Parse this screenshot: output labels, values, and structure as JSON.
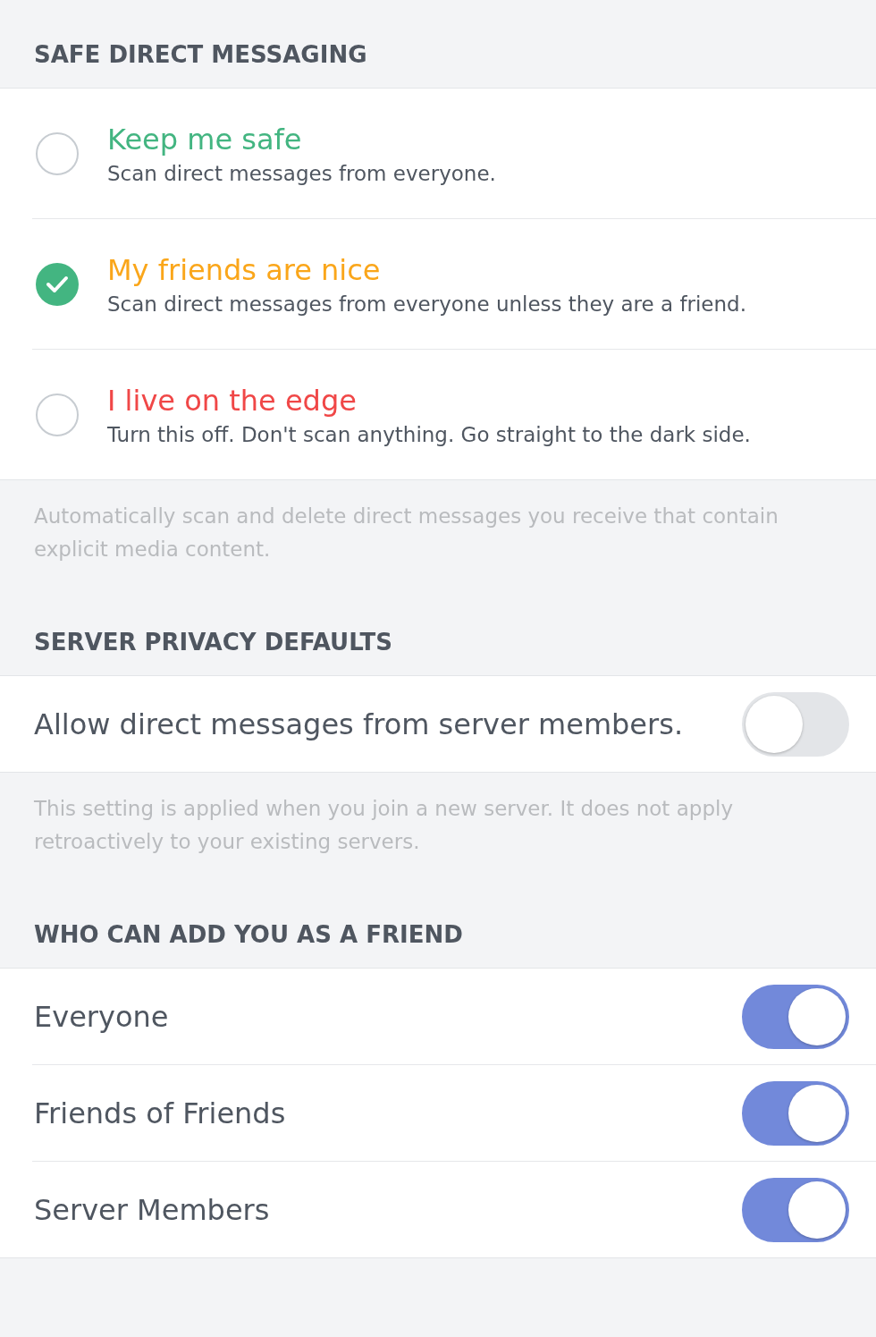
{
  "sections": [
    {
      "title": "SAFE DIRECT MESSAGING",
      "kind": "radio",
      "options": [
        {
          "title": "Keep me safe",
          "description": "Scan direct messages from everyone.",
          "color": "#43b581",
          "selected": false
        },
        {
          "title": "My friends are nice",
          "description": "Scan direct messages from everyone unless they are a friend.",
          "color": "#faa61a",
          "selected": true
        },
        {
          "title": "I live on the edge",
          "description": "Turn this off. Don't scan anything. Go straight to the dark side.",
          "color": "#f04747",
          "selected": false
        }
      ],
      "note": "Automatically scan and delete direct messages you receive that contain explicit media content."
    },
    {
      "title": "SERVER PRIVACY DEFAULTS",
      "kind": "toggle",
      "options": [
        {
          "title": "Allow direct messages from server members.",
          "on": false
        }
      ],
      "note": "This setting is applied when you join a new server. It does not apply retroactively to your existing servers."
    },
    {
      "title": "WHO CAN ADD YOU AS A FRIEND",
      "kind": "toggle",
      "options": [
        {
          "title": "Everyone",
          "on": true
        },
        {
          "title": "Friends of Friends",
          "on": true
        },
        {
          "title": "Server Members",
          "on": true
        }
      ]
    }
  ]
}
